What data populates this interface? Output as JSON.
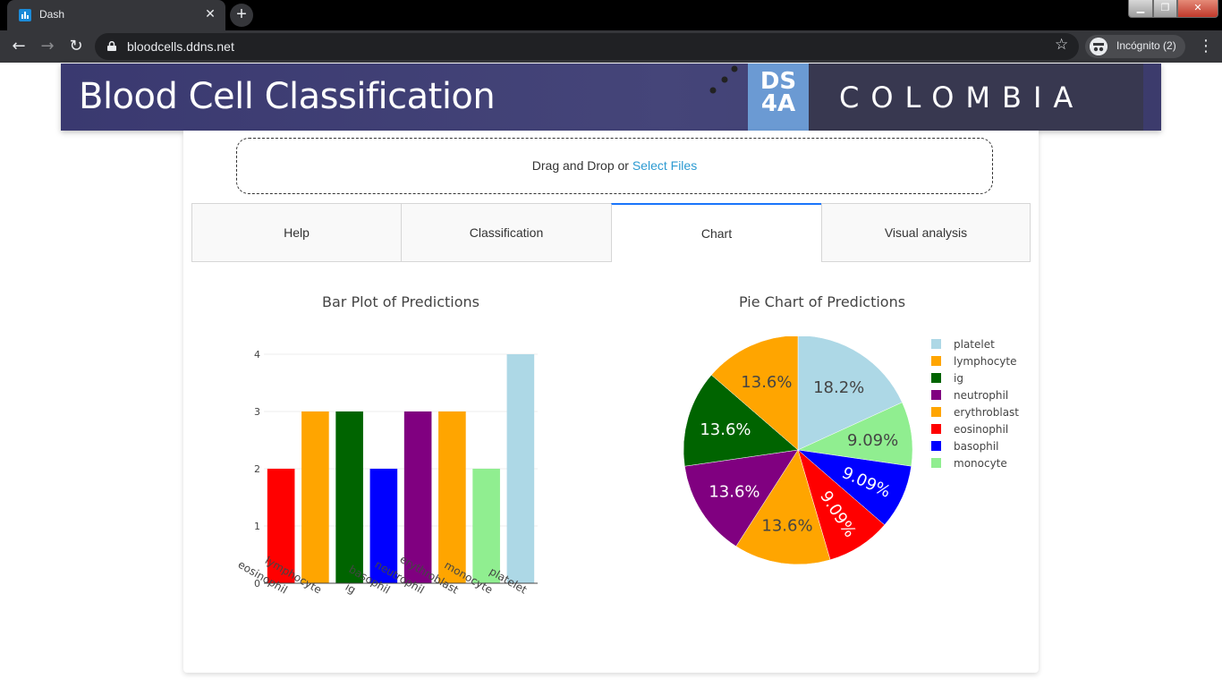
{
  "browser": {
    "tab_title": "Dash",
    "url": "bloodcells.ddns.net",
    "profile_label": "Incógnito (2)"
  },
  "banner": {
    "title": "Blood Cell Classification",
    "logo_top": "DS",
    "logo_bottom": "4A",
    "logo_word": "COLOMBIA"
  },
  "upload": {
    "text": "Drag and Drop or ",
    "link": "Select Files"
  },
  "tabs": [
    {
      "label": "Help",
      "active": false
    },
    {
      "label": "Classification",
      "active": false
    },
    {
      "label": "Chart",
      "active": true
    },
    {
      "label": "Visual analysis",
      "active": false
    }
  ],
  "chart_data": [
    {
      "type": "bar",
      "title": "Bar Plot of Predictions",
      "categories": [
        "eosinophil",
        "lymphocyte",
        "ig",
        "basophil",
        "neutrophil",
        "erythroblast",
        "monocyte",
        "platelet"
      ],
      "values": [
        2,
        3,
        3,
        2,
        3,
        3,
        2,
        4
      ],
      "colors": [
        "#ff0000",
        "#ffa500",
        "#006400",
        "#0000ff",
        "#800080",
        "#ffa500",
        "#90ee90",
        "#add8e6"
      ],
      "yticks": [
        "0",
        "1",
        "2",
        "3",
        "4"
      ],
      "ylim": [
        0,
        4
      ],
      "grid": true
    },
    {
      "type": "pie",
      "title": "Pie Chart of Predictions",
      "labels": [
        "platelet",
        "monocyte",
        "basophil",
        "eosinophil",
        "erythroblast",
        "neutrophil",
        "ig",
        "lymphocyte"
      ],
      "values": [
        4,
        2,
        2,
        2,
        3,
        3,
        3,
        3
      ],
      "percent_labels": [
        "18.2%",
        "9.09%",
        "9.09%",
        "9.09%",
        "13.6%",
        "13.6%",
        "13.6%",
        "13.6%"
      ],
      "colors": [
        "#add8e6",
        "#90ee90",
        "#0000ff",
        "#ff0000",
        "#ffa500",
        "#800080",
        "#006400",
        "#ffa500"
      ],
      "legend": [
        {
          "label": "platelet",
          "color": "#add8e6"
        },
        {
          "label": "lymphocyte",
          "color": "#ffa500"
        },
        {
          "label": "ig",
          "color": "#006400"
        },
        {
          "label": "neutrophil",
          "color": "#800080"
        },
        {
          "label": "erythroblast",
          "color": "#ffa500"
        },
        {
          "label": "eosinophil",
          "color": "#ff0000"
        },
        {
          "label": "basophil",
          "color": "#0000ff"
        },
        {
          "label": "monocyte",
          "color": "#90ee90"
        }
      ],
      "legend_position": "right"
    }
  ]
}
